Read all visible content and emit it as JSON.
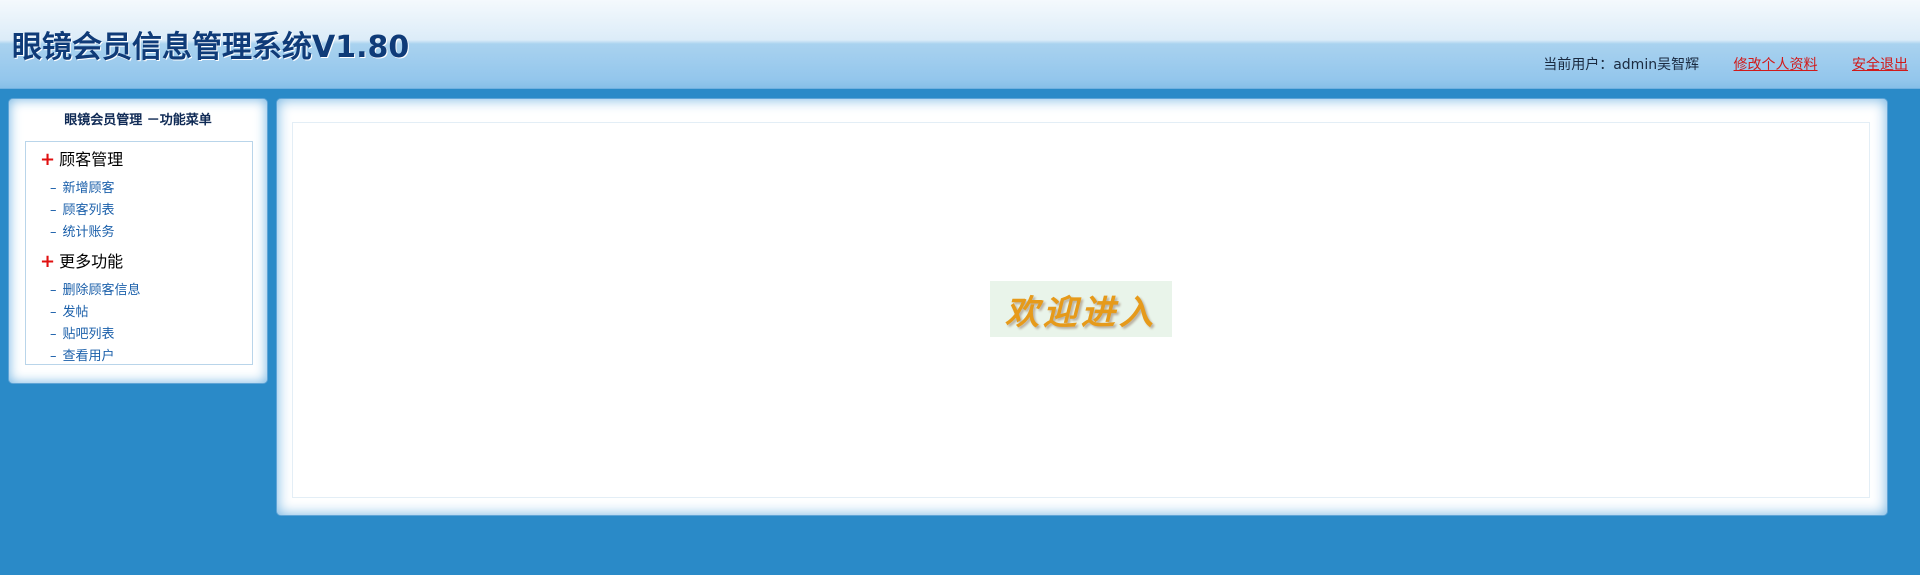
{
  "header": {
    "title": "眼镜会员信息管理系统V1.80",
    "current_user": "当前用户：admin吴智辉",
    "edit_profile": "修改个人资料",
    "logout": "安全退出"
  },
  "sidebar": {
    "title": "眼镜会员管理 －功能菜单",
    "groups": [
      {
        "label": "顾客管理",
        "items": [
          {
            "label": "新增顾客"
          },
          {
            "label": "顾客列表"
          },
          {
            "label": "统计账务"
          }
        ]
      },
      {
        "label": "更多功能",
        "items": [
          {
            "label": "删除顾客信息"
          },
          {
            "label": "发帖"
          },
          {
            "label": "贴吧列表"
          },
          {
            "label": "查看用户"
          }
        ]
      }
    ],
    "plus_symbol": "+",
    "dash_symbol": "–"
  },
  "main": {
    "welcome_text": "欢迎进入"
  },
  "colors": {
    "background": "#2a8ac8",
    "title": "#0f3b78",
    "link_red": "#d11a1a",
    "menu_link": "#1a5faa",
    "welcome": "#e69a1a"
  },
  "icons": [
    "plus-icon",
    "dash-icon"
  ]
}
